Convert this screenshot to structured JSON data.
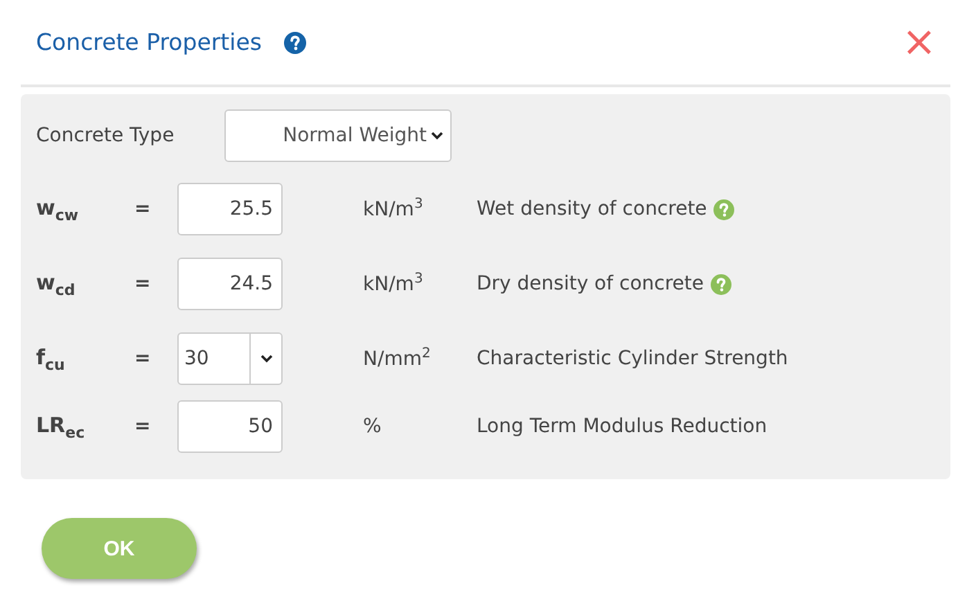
{
  "dialog": {
    "title": "Concrete Properties",
    "help": true,
    "close": "×"
  },
  "concrete_type": {
    "label": "Concrete Type",
    "value": "Normal Weight"
  },
  "rows": [
    {
      "kind": "input",
      "symbol": "w$_{cw}$",
      "equals": "=",
      "value": "25.5",
      "unit": "kN/m$^{3}$",
      "description": "Wet density of concrete",
      "help": true
    },
    {
      "kind": "input",
      "symbol": "w$_{cd}$",
      "equals": "=",
      "value": "24.5",
      "unit": "kN/m$^{3}$",
      "description": "Dry density of concrete",
      "help": true
    },
    {
      "kind": "select",
      "symbol": "f$_{cu}$",
      "equals": "=",
      "value": "30",
      "unit": "N/mm$^{2}$",
      "description": "Characteristic Cylinder Strength",
      "help": false
    },
    {
      "kind": "input",
      "symbol": "LR$_{ec}$",
      "equals": "=",
      "value": "50",
      "unit": "%",
      "description": "Long Term Modulus Reduction",
      "help": false
    }
  ],
  "buttons": [
    "OK"
  ]
}
